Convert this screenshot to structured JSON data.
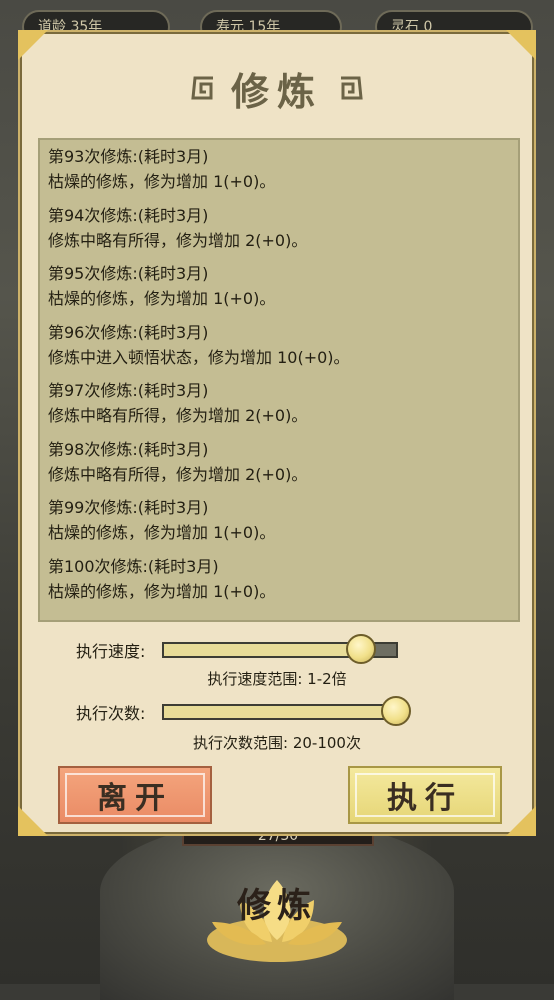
{
  "background": {
    "stats": [
      "道龄 35年",
      "寿元 15年",
      "灵石 0"
    ],
    "progress": "27/30",
    "lotus_label": "修炼"
  },
  "dialog": {
    "title": "修炼",
    "log": [
      {
        "head": "第93次修炼:(耗时3月)",
        "body": "枯燥的修炼，修为增加 1(+0)。"
      },
      {
        "head": "第94次修炼:(耗时3月)",
        "body": "修炼中略有所得，修为增加 2(+0)。"
      },
      {
        "head": "第95次修炼:(耗时3月)",
        "body": "枯燥的修炼，修为增加 1(+0)。"
      },
      {
        "head": "第96次修炼:(耗时3月)",
        "body": "修炼中进入顿悟状态，修为增加 10(+0)。"
      },
      {
        "head": "第97次修炼:(耗时3月)",
        "body": "修炼中略有所得，修为增加 2(+0)。"
      },
      {
        "head": "第98次修炼:(耗时3月)",
        "body": "修炼中略有所得，修为增加 2(+0)。"
      },
      {
        "head": "第99次修炼:(耗时3月)",
        "body": "枯燥的修炼，修为增加 1(+0)。"
      },
      {
        "head": "第100次修炼:(耗时3月)",
        "body": "枯燥的修炼，修为增加 1(+0)。"
      }
    ],
    "speed": {
      "label": "执行速度:",
      "range_text": "执行速度范围: 1-2倍",
      "fraction": 0.85
    },
    "count": {
      "label": "执行次数:",
      "range_text": "执行次数范围: 20-100次",
      "fraction": 1.0
    },
    "buttons": {
      "leave": "离开",
      "execute": "执行"
    }
  },
  "colors": {
    "dialog_bg": "#efe3c6",
    "log_bg": "#c4bd93",
    "leave_btn": "#ea8b65",
    "execute_btn": "#e6d677",
    "accent_gold": "#e4c25e"
  }
}
